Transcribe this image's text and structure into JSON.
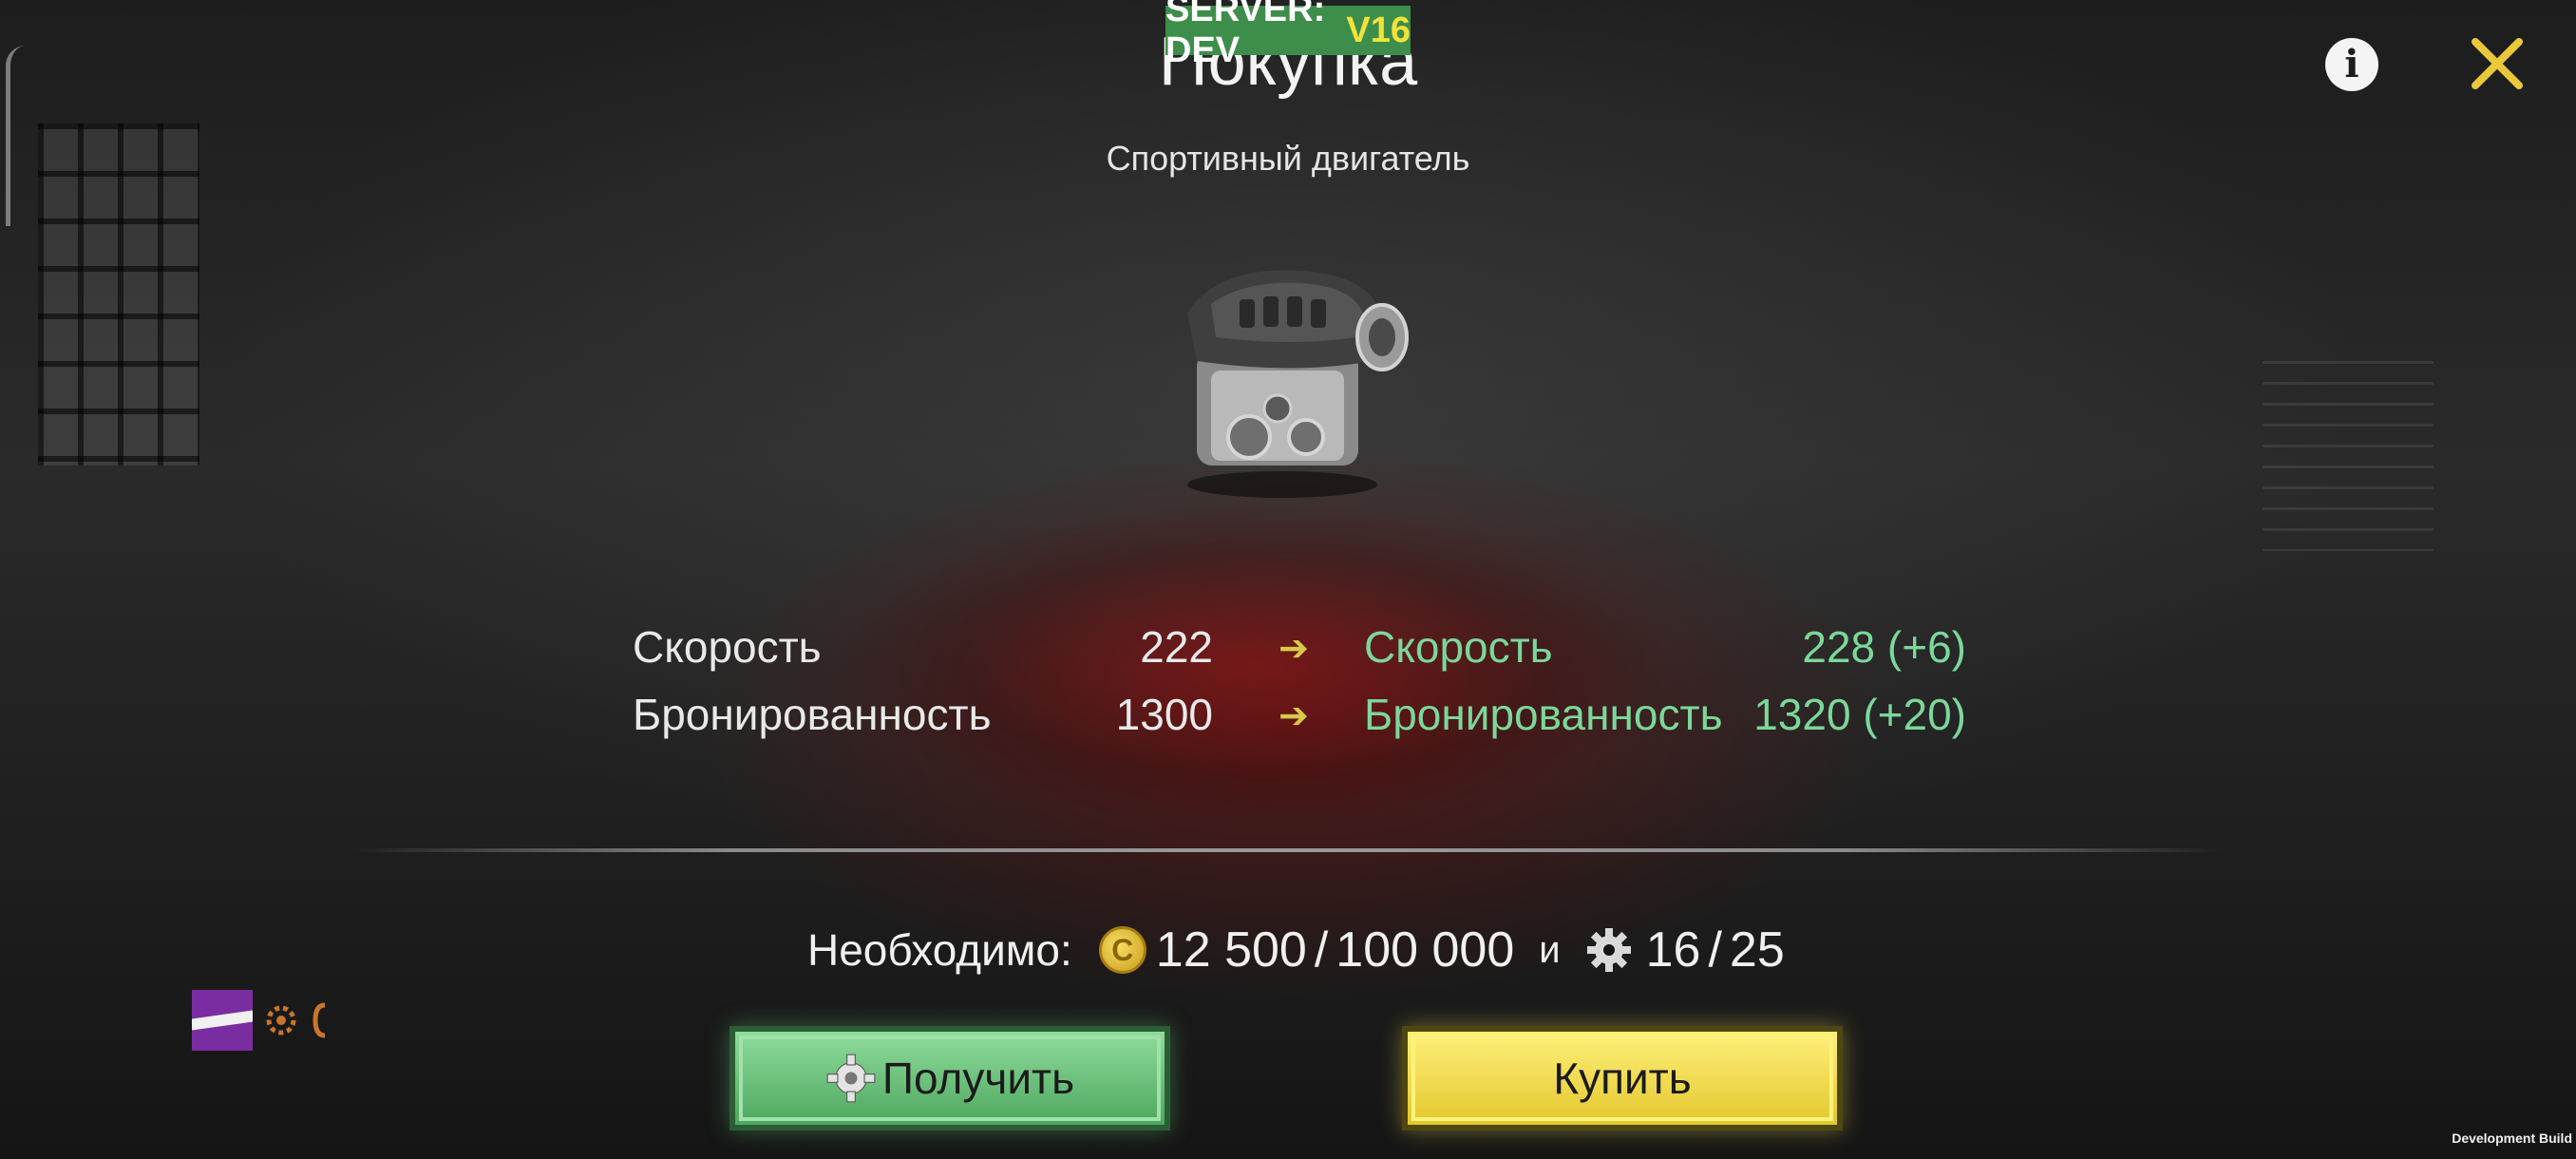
{
  "header": {
    "server_label": "SERVER: DEV",
    "version": "V16",
    "title": "Покупка",
    "subtitle": "Спортивный двигатель"
  },
  "icons": {
    "info": "info-icon",
    "close": "close-icon",
    "engine": "engine-image",
    "coin": "coin-icon",
    "gear": "gear-icon"
  },
  "stats": [
    {
      "label": "Скорость",
      "current": "222",
      "new_label": "Скорость",
      "new_value": "228 (+6)"
    },
    {
      "label": "Бронированность",
      "current": "1300",
      "new_label": "Бронированность",
      "new_value": "1320 (+20)"
    }
  ],
  "requirements": {
    "label": "Необходимо:",
    "coins_have": "12 500",
    "coins_need": "100 000",
    "conjunction": "и",
    "parts_have": "16",
    "parts_need": "25",
    "separator": "/"
  },
  "buttons": {
    "get_label": "Получить",
    "buy_label": "Купить"
  },
  "footer": {
    "build_label": "Development Build"
  },
  "colors": {
    "accent_green": "#7bd79a",
    "button_green": "#5fb970",
    "button_yellow": "#f0d84a",
    "version_yellow": "#f2e23c",
    "badge_green": "#3d8e4a"
  }
}
